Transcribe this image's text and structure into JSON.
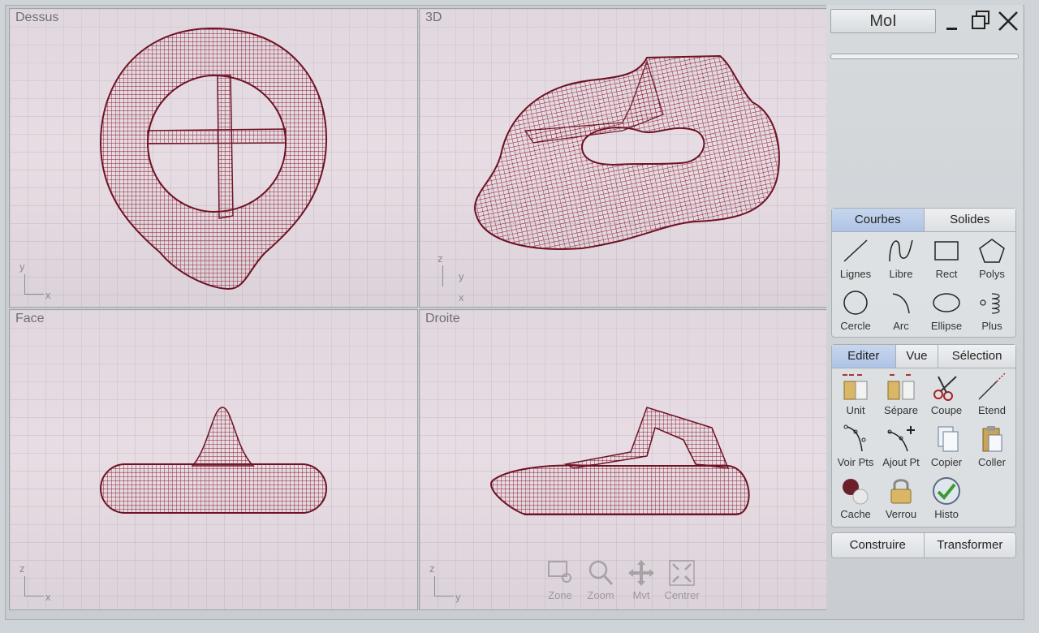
{
  "viewports": {
    "top": {
      "label": "Dessus",
      "axis_v": "y",
      "axis_h": "x"
    },
    "perspective": {
      "label": "3D",
      "axis_z": "z",
      "axis_y": "y",
      "axis_x": "x"
    },
    "front": {
      "label": "Face",
      "axis_v": "z",
      "axis_h": "x"
    },
    "right": {
      "label": "Droite",
      "axis_v": "z",
      "axis_h": "y"
    }
  },
  "nav_tools": [
    "Zone",
    "Zoom",
    "Mvt",
    "Centrer"
  ],
  "panel": {
    "title": "MoI",
    "curves_tabs": [
      "Courbes",
      "Solides"
    ],
    "curves_tools": [
      {
        "label": "Lignes",
        "icon": "line-icon"
      },
      {
        "label": "Libre",
        "icon": "freehand-curve-icon"
      },
      {
        "label": "Rect",
        "icon": "rectangle-icon"
      },
      {
        "label": "Polys",
        "icon": "polygon-icon"
      },
      {
        "label": "Cercle",
        "icon": "circle-icon"
      },
      {
        "label": "Arc",
        "icon": "arc-icon"
      },
      {
        "label": "Ellipse",
        "icon": "ellipse-icon"
      },
      {
        "label": "Plus",
        "icon": "more-icon"
      }
    ],
    "edit_tabs": [
      "Editer",
      "Vue",
      "Sélection"
    ],
    "edit_tools": [
      {
        "label": "Unit",
        "icon": "join-icon"
      },
      {
        "label": "Sépare",
        "icon": "separate-icon"
      },
      {
        "label": "Coupe",
        "icon": "scissors-icon"
      },
      {
        "label": "Etend",
        "icon": "extend-icon"
      },
      {
        "label": "Voir Pts",
        "icon": "show-points-icon"
      },
      {
        "label": "Ajout Pt",
        "icon": "add-point-icon"
      },
      {
        "label": "Copier",
        "icon": "copy-icon"
      },
      {
        "label": "Coller",
        "icon": "paste-icon"
      },
      {
        "label": "Cache",
        "icon": "hide-icon"
      },
      {
        "label": "Verrou",
        "icon": "lock-icon"
      },
      {
        "label": "Histo",
        "icon": "history-icon"
      }
    ],
    "bottom_tabs": [
      "Construire",
      "Transformer"
    ]
  },
  "colors": {
    "wire": "#8b1a2e",
    "tab_active": "#b7cbea",
    "viewport_bg": "#e6dce2"
  }
}
